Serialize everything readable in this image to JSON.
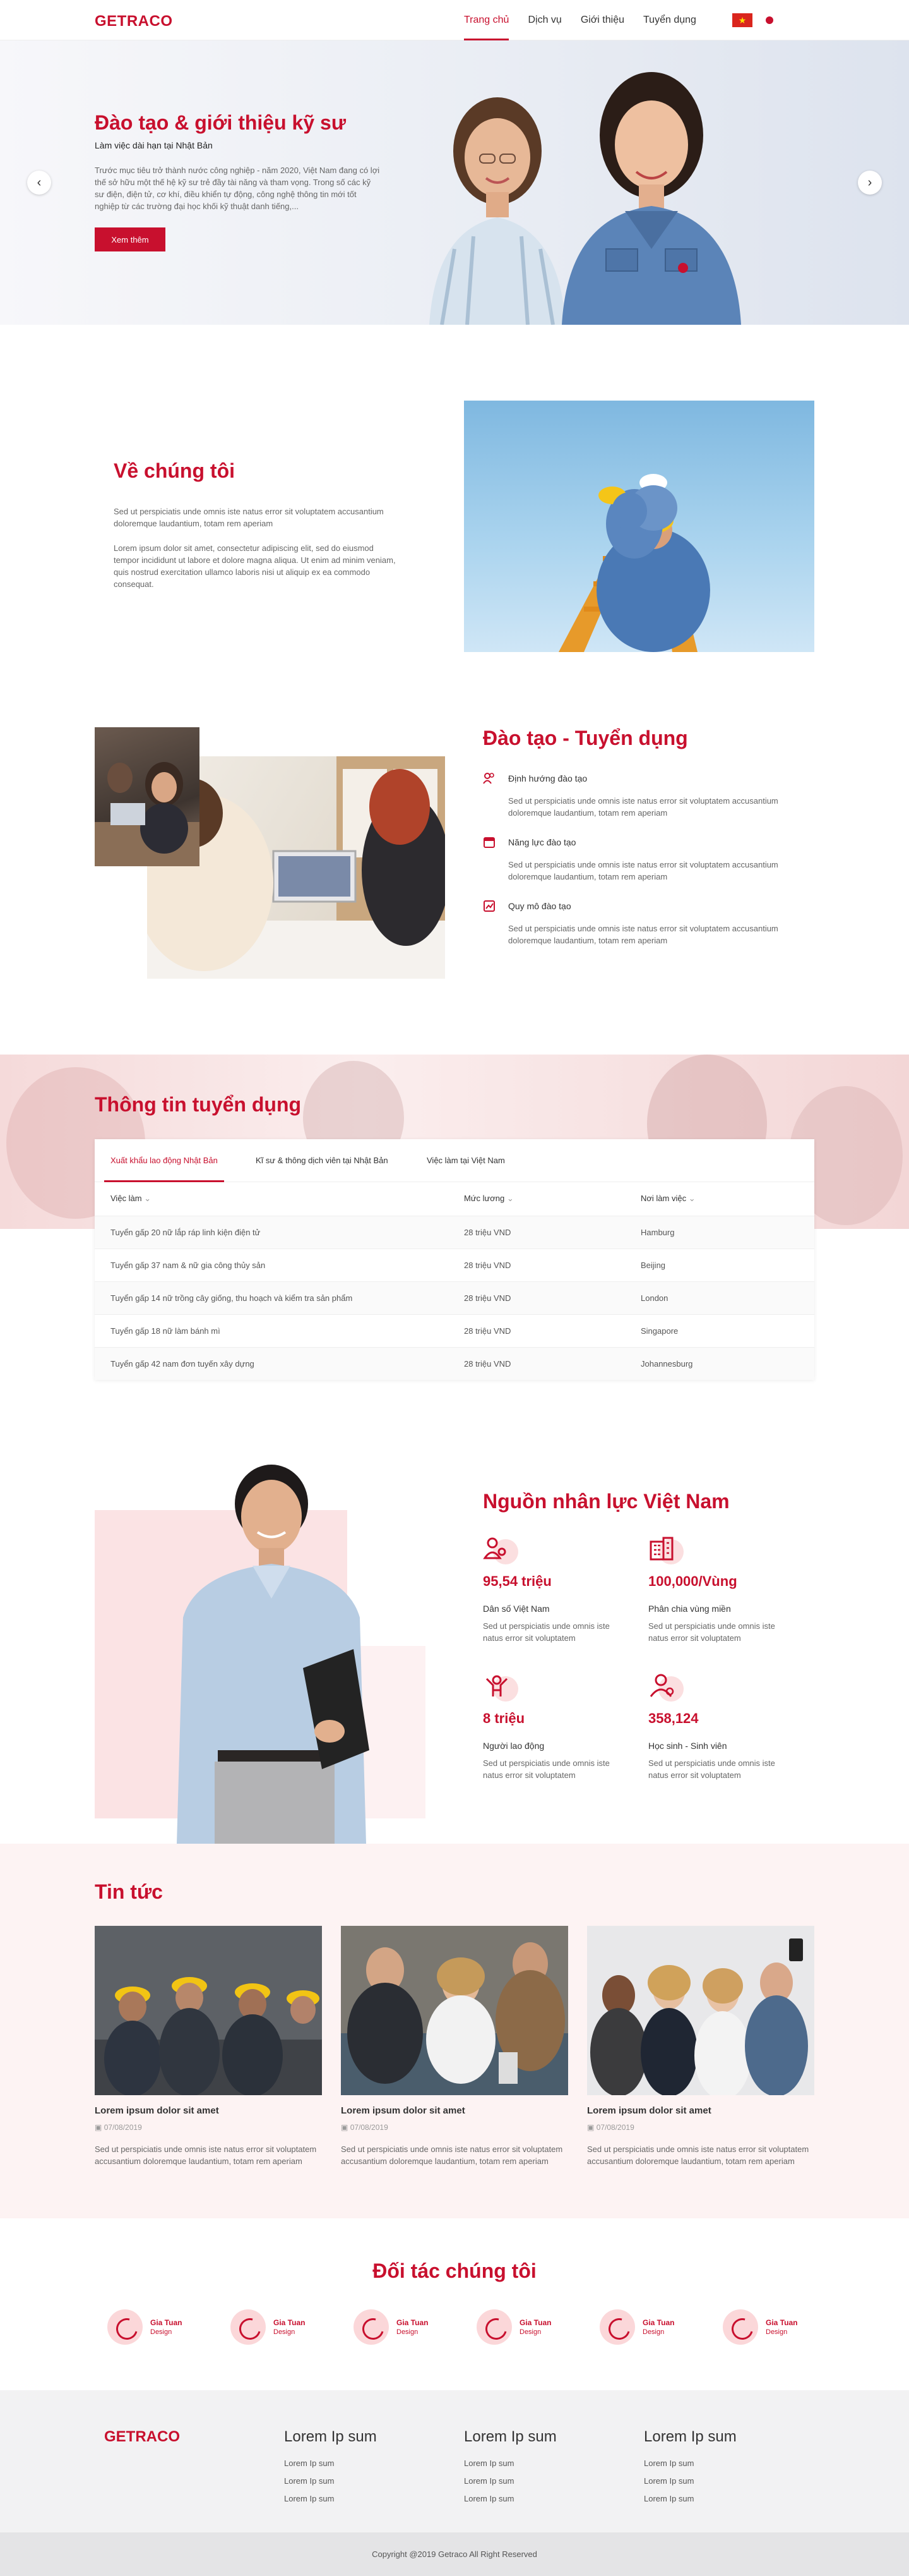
{
  "header": {
    "logo": "GETRACO",
    "nav": [
      "Trang chủ",
      "Dịch vụ",
      "Giới thiệu",
      "Tuyển dụng"
    ],
    "flag_icon": "vietnam-flag-icon"
  },
  "hero": {
    "title": "Đào tạo & giới thiệu kỹ sư",
    "subtitle": "Làm việc dài hạn tại Nhật Bản",
    "description": "Trước mục tiêu trở thành nước công nghiệp - năm 2020, Việt Nam đang có lợi thế sở hữu một thế hệ kỹ sư trẻ đầy tài năng và tham vọng. Trong số các kỹ sư điện, điện tử, cơ khí, điều khiển tự động, công nghệ thông tin mới tốt nghiệp từ các trường đại học khối kỹ thuật danh tiếng,...",
    "button": "Xem thêm"
  },
  "about": {
    "title": "Về chúng tôi",
    "p1": "Sed ut perspiciatis unde omnis iste natus error sit voluptatem accusantium doloremque laudantium, totam rem aperiam",
    "p2": "Lorem ipsum dolor sit amet, consectetur adipiscing elit, sed do eiusmod tempor incididunt ut labore et dolore magna aliqua. Ut enim ad minim veniam, quis nostrud exercitation ullamco laboris nisi ut aliquip ex ea commodo consequat."
  },
  "training": {
    "title": "Đào tạo - Tuyển dụng",
    "features": [
      {
        "title": "Định hướng đào tạo",
        "desc": "Sed ut perspiciatis unde omnis iste natus error sit voluptatem accusantium doloremque laudantium, totam rem aperiam",
        "icon": "people-icon"
      },
      {
        "title": "Năng lực đào tạo",
        "desc": "Sed ut perspiciatis unde omnis iste natus error sit voluptatem accusantium doloremque laudantium, totam rem aperiam",
        "icon": "calendar-icon"
      },
      {
        "title": "Quy mô đào tạo",
        "desc": "Sed ut perspiciatis unde omnis iste natus error sit voluptatem accusantium doloremque laudantium, totam rem aperiam",
        "icon": "chart-icon"
      }
    ]
  },
  "jobs": {
    "title": "Thông tin tuyển dụng",
    "tabs": [
      "Xuất khẩu lao động Nhật Bản",
      "Kĩ sư & thông dịch viên tại Nhật Bản",
      "Việc làm tại Việt Nam"
    ],
    "columns": [
      "Việc làm",
      "Mức lương",
      "Nơi làm việc"
    ],
    "rows": [
      [
        "Tuyển gấp 20 nữ lắp ráp linh kiện điện tử",
        "28 triệu VND",
        "Hamburg"
      ],
      [
        "Tuyển gấp 37 nam & nữ gia công thủy sản",
        "28 triệu VND",
        "Beijing"
      ],
      [
        "Tuyển gấp 14 nữ trồng cây giống, thu hoạch và kiểm tra sản phẩm",
        "28 triệu VND",
        "London"
      ],
      [
        "Tuyển gấp 18 nữ làm bánh mì",
        "28 triệu VND",
        "Singapore"
      ],
      [
        "Tuyển gấp 42 nam đơn tuyến xây dựng",
        "28 triệu VND",
        "Johannesburg"
      ]
    ]
  },
  "resources": {
    "title": "Nguồn nhân lực Việt Nam",
    "stats": [
      {
        "value": "95,54 triệu",
        "label": "Dân số Việt Nam",
        "desc": "Sed ut perspiciatis unde omnis iste natus error sit voluptatem",
        "icon": "population-icon"
      },
      {
        "value": "100,000/Vùng",
        "label": "Phân chia vùng miền",
        "desc": "Sed ut perspiciatis unde omnis iste natus error sit voluptatem",
        "icon": "building-icon"
      },
      {
        "value": "8 triệu",
        "label": "Người lao động",
        "desc": "Sed ut perspiciatis unde omnis iste natus error sit voluptatem",
        "icon": "worker-icon"
      },
      {
        "value": "358,124",
        "label": "Học sinh - Sinh viên",
        "desc": "Sed ut perspiciatis unde omnis iste natus error sit voluptatem",
        "icon": "student-icon"
      }
    ]
  },
  "news": {
    "title": "Tin tức",
    "items": [
      {
        "title": "Lorem ipsum dolor sit amet",
        "date": "07/08/2019",
        "desc": "Sed ut perspiciatis unde omnis iste natus error sit voluptatem accusantium doloremque laudantium, totam rem aperiam"
      },
      {
        "title": "Lorem ipsum dolor sit amet",
        "date": "07/08/2019",
        "desc": "Sed ut perspiciatis unde omnis iste natus error sit voluptatem accusantium doloremque laudantium, totam rem aperiam"
      },
      {
        "title": "Lorem ipsum dolor sit amet",
        "date": "07/08/2019",
        "desc": "Sed ut perspiciatis unde omnis iste natus error sit voluptatem accusantium doloremque laudantium, totam rem aperiam"
      }
    ]
  },
  "partners": {
    "title": "Đối tác chúng tôi",
    "items": [
      {
        "name": "Gia Tuan",
        "sub": "Design"
      },
      {
        "name": "Gia Tuan",
        "sub": "Design"
      },
      {
        "name": "Gia Tuan",
        "sub": "Design"
      },
      {
        "name": "Gia Tuan",
        "sub": "Design"
      },
      {
        "name": "Gia Tuan",
        "sub": "Design"
      },
      {
        "name": "Gia Tuan",
        "sub": "Design"
      }
    ]
  },
  "footer": {
    "logo": "GETRACO",
    "columns": [
      {
        "title": "Lorem Ip sum",
        "links": [
          "Lorem Ip sum",
          "Lorem Ip sum",
          "Lorem Ip sum"
        ]
      },
      {
        "title": "Lorem Ip sum",
        "links": [
          "Lorem Ip sum",
          "Lorem Ip sum",
          "Lorem Ip sum"
        ]
      },
      {
        "title": "Lorem Ip sum",
        "links": [
          "Lorem Ip sum",
          "Lorem Ip sum",
          "Lorem Ip sum"
        ]
      }
    ],
    "copyright": "Copyright @2019 Getraco All Right Reserved"
  },
  "colors": {
    "accent": "#c8102e",
    "pink_bg": "#fdf3f3"
  }
}
